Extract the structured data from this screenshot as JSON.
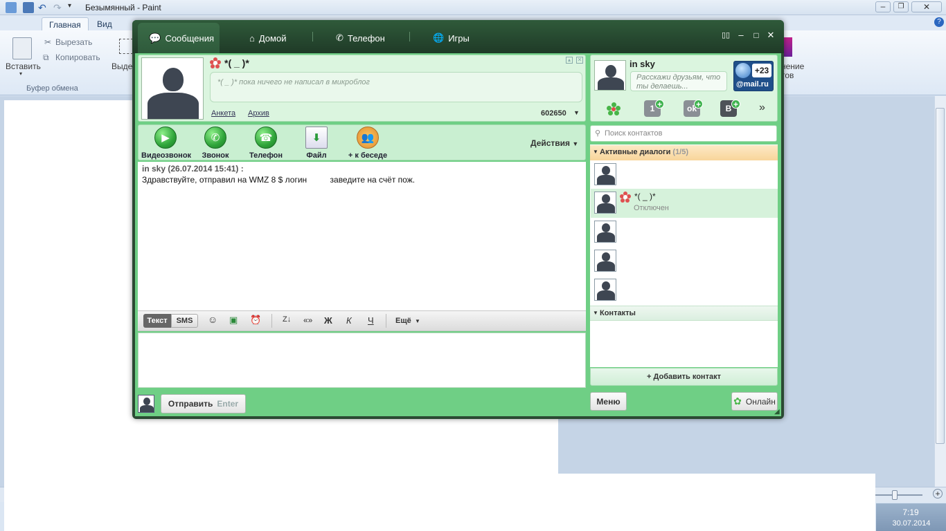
{
  "paint": {
    "title": "Безымянный - Paint",
    "tabs": [
      "Главная",
      "Вид"
    ],
    "ribbon": {
      "paste": "Вставить",
      "cut": "Вырезать",
      "copy": "Копировать",
      "clipboard_group": "Буфер обмена",
      "select_partial": "Выде",
      "right_partial_1": "нение",
      "right_partial_2": "тов"
    }
  },
  "taskbar": {
    "time": "7:19",
    "date": "30.07.2014"
  },
  "icq": {
    "nav": {
      "messages": "Сообщения",
      "home": "Домой",
      "phone": "Телефон",
      "games": "Игры"
    },
    "contact_card": {
      "name": "*( _ )*",
      "microblog_placeholder": "*( _ )* пока ничего не написал в микроблог",
      "profile_link": "Анкета",
      "archive_link": "Архив",
      "uin": "602650"
    },
    "actions": {
      "video_call": "Видеозвонок",
      "call": "Звонок",
      "phone": "Телефон",
      "file": "Файл",
      "add_to_chat": "+ к беседе",
      "more": "Действия"
    },
    "messages": [
      {
        "header": "in sky (26.07.2014 15:41) :",
        "text": "Здравствуйте, отправил на WMZ 8 $ логин          заведите на счёт пож."
      }
    ],
    "compose_toolbar": {
      "text_mode": "Текст",
      "sms_mode": "SMS",
      "translit": "«»",
      "bold": "Ж",
      "italic": "К",
      "underline": "Ч",
      "more": "Ещё"
    },
    "send": {
      "label": "Отправить",
      "hint": "Enter"
    },
    "me": {
      "name": "in sky",
      "status_placeholder": "Расскажи друзьям, что ты делаешь...",
      "mail_badge": "+23",
      "mail_brand": "@mail.ru"
    },
    "search_placeholder": "Поиск контактов",
    "active_dialogs": {
      "label": "Активные диалоги",
      "count": "(1/5)"
    },
    "dialogs": [
      {
        "name": "",
        "status": ""
      },
      {
        "name": "*( _ )*",
        "status": "Отключен"
      },
      {
        "name": "",
        "status": ""
      },
      {
        "name": "",
        "status": ""
      },
      {
        "name": "",
        "status": ""
      }
    ],
    "contacts_label": "Контакты",
    "add_contact": "+ Добавить контакт",
    "menu_button": "Меню",
    "online_button": "Онлайн",
    "colors": {
      "accent_green": "#6fcf85",
      "dark_header": "#2b4a33",
      "dialogs_header": "#fce0b0"
    }
  }
}
